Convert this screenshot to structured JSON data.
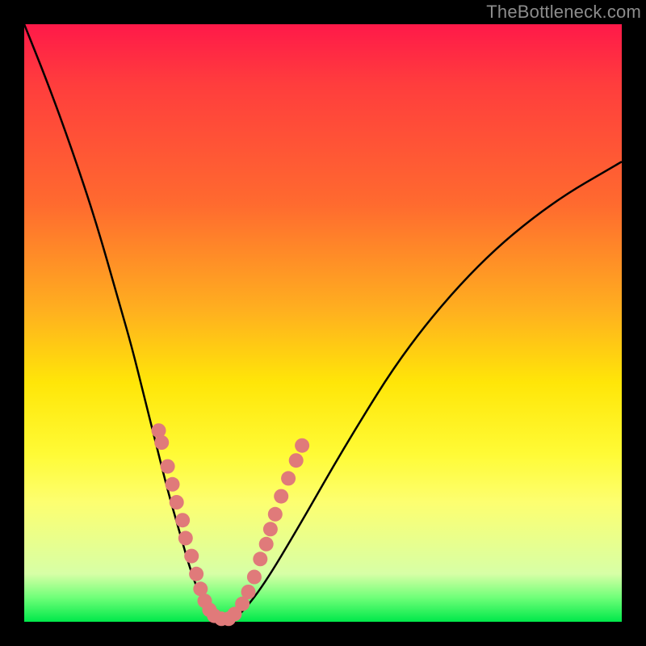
{
  "watermark": "TheBottleneck.com",
  "colors": {
    "background": "#000000",
    "curve_stroke": "#000000",
    "dot_fill": "#e07a7a",
    "watermark": "#8c8c8c"
  },
  "chart_data": {
    "type": "line",
    "title": "",
    "xlabel": "",
    "ylabel": "",
    "xlim": [
      0,
      100
    ],
    "ylim": [
      0,
      100
    ],
    "grid": false,
    "series": [
      {
        "name": "bottleneck-curve",
        "x": [
          0,
          4,
          8,
          12,
          16,
          18,
          20,
          22,
          24,
          26,
          28,
          30,
          32,
          34,
          36,
          40,
          46,
          54,
          64,
          76,
          88,
          100
        ],
        "y": [
          100,
          90,
          79,
          67,
          53,
          46,
          38,
          30,
          22,
          15,
          8,
          3,
          1,
          0,
          1,
          6,
          16,
          30,
          46,
          60,
          70,
          77
        ]
      }
    ],
    "annotations": {
      "dots": [
        {
          "x": 22.5,
          "y": 32.0
        },
        {
          "x": 23.0,
          "y": 30.0
        },
        {
          "x": 24.0,
          "y": 26.0
        },
        {
          "x": 24.8,
          "y": 23.0
        },
        {
          "x": 25.5,
          "y": 20.0
        },
        {
          "x": 26.5,
          "y": 17.0
        },
        {
          "x": 27.0,
          "y": 14.0
        },
        {
          "x": 28.0,
          "y": 11.0
        },
        {
          "x": 28.8,
          "y": 8.0
        },
        {
          "x": 29.5,
          "y": 5.5
        },
        {
          "x": 30.2,
          "y": 3.5
        },
        {
          "x": 31.0,
          "y": 2.0
        },
        {
          "x": 31.8,
          "y": 1.0
        },
        {
          "x": 33.0,
          "y": 0.5
        },
        {
          "x": 34.2,
          "y": 0.5
        },
        {
          "x": 35.2,
          "y": 1.3
        },
        {
          "x": 36.5,
          "y": 3.0
        },
        {
          "x": 37.5,
          "y": 5.0
        },
        {
          "x": 38.5,
          "y": 7.5
        },
        {
          "x": 39.5,
          "y": 10.5
        },
        {
          "x": 40.5,
          "y": 13.0
        },
        {
          "x": 41.2,
          "y": 15.5
        },
        {
          "x": 42.0,
          "y": 18.0
        },
        {
          "x": 43.0,
          "y": 21.0
        },
        {
          "x": 44.2,
          "y": 24.0
        },
        {
          "x": 45.5,
          "y": 27.0
        },
        {
          "x": 46.5,
          "y": 29.5
        }
      ]
    }
  }
}
